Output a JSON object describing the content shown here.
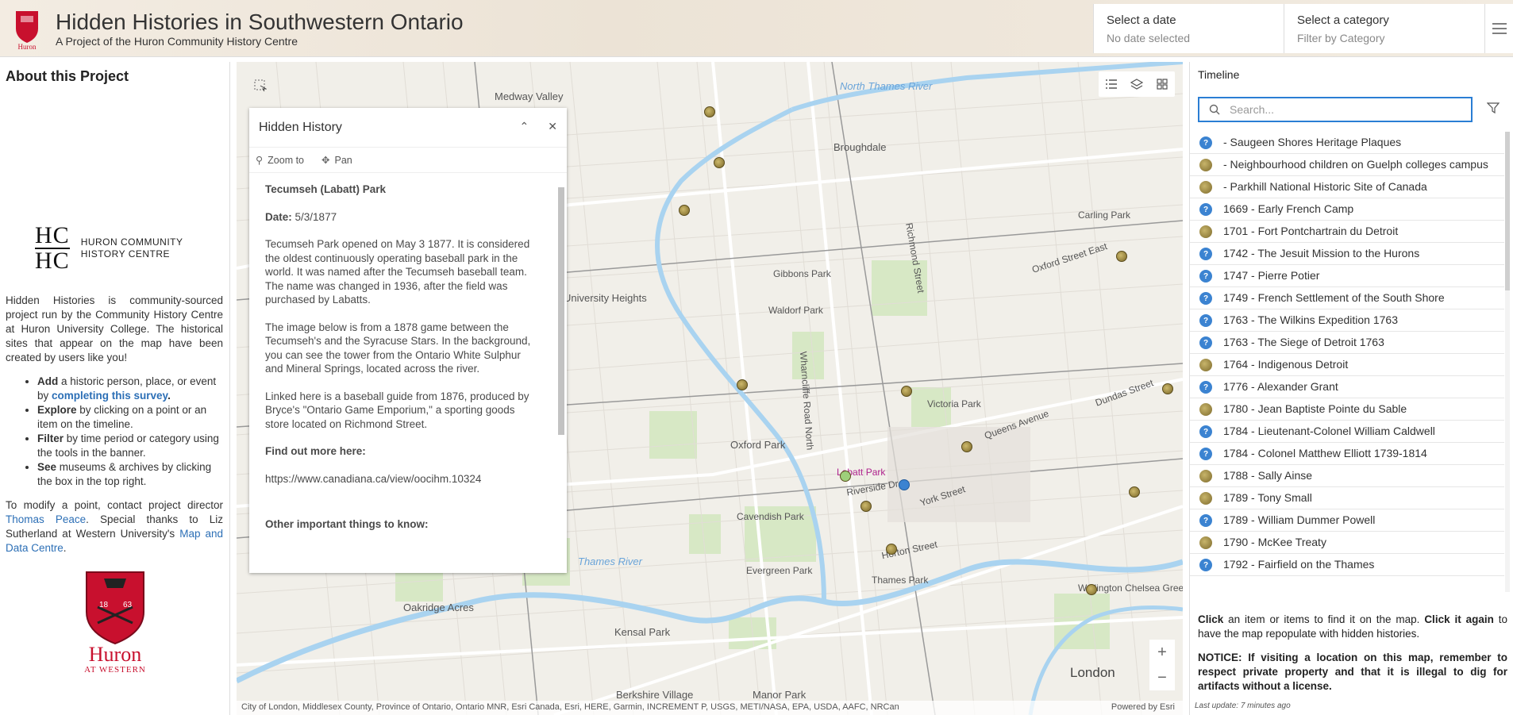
{
  "header": {
    "logo_text": "Huron",
    "title": "Hidden Histories in Southwestern Ontario",
    "subtitle": "A Project of the Huron Community History Centre",
    "date_filter": {
      "label": "Select a date",
      "value": "No date selected"
    },
    "category_filter": {
      "label": "Select a category",
      "placeholder": "Filter by Category"
    }
  },
  "about": {
    "heading": "About this Project",
    "logo_letters_top": "HC",
    "logo_letters_bottom": "HC",
    "logo_line1": "HURON COMMUNITY",
    "logo_line2": "HISTORY CENTRE",
    "intro": "Hidden Histories is community-sourced project run by the Community History Centre at Huron University College. The historical sites that appear on the map have been created by users like you!",
    "bullets": [
      {
        "bold": "Add",
        "pre": " a historic person, place, or event by ",
        "link": "completing this survey",
        "post": "."
      },
      {
        "bold": "Explore",
        "text": " by clicking on a point or an item on the timeline."
      },
      {
        "bold": "Filter",
        "text": " by time period or category using the tools in the banner."
      },
      {
        "bold": "See",
        "text": " museums & archives by clicking the box in the top right."
      }
    ],
    "contact_pre": "To modify a point, contact project director ",
    "contact_name": "Thomas Peace",
    "contact_mid": ". Special thanks to Liz Sutherland at Western University's ",
    "contact_link": "Map and Data Centre",
    "contact_post": ".",
    "shield_left": "18",
    "shield_right": "63",
    "brand": "Huron",
    "brand_sub": "AT WESTERN"
  },
  "popup": {
    "title": "Hidden History",
    "zoom_label": "Zoom to",
    "pan_label": "Pan",
    "place": "Tecumseh (Labatt) Park",
    "date_label": "Date:",
    "date_value": "5/3/1877",
    "para1": "Tecumseh Park opened on May 3 1877. It is considered the oldest continuously operating baseball park in the world. It was named after the Tecumseh baseball team. The name was changed in 1936, after the field was purchased by Labatts.",
    "para2": "The image below is from a 1878 game between the Tecumseh's and the Syracuse Stars. In the background, you can see the tower from the Ontario White Sulphur and Mineral Springs, located across the river.",
    "para3": "Linked here is a baseball guide from 1876, produced by Bryce's \"Ontario Game Emporium,\" a sporting goods store located on Richmond Street.",
    "find_more": "Find out more here:",
    "url": "https://www.canadiana.ca/view/oocihm.10324",
    "other": "Other important things to know:"
  },
  "map": {
    "labels": {
      "north_thames": "North Thames River",
      "thames": "Thames River",
      "broughdale": "Broughdale",
      "university_heights": "University Heights",
      "oxford_park": "Oxford Park",
      "london": "London",
      "kensal_park": "Kensal Park",
      "oakridge": "Oakridge Acres",
      "berkshire": "Berkshire Village",
      "manor_park": "Manor Park",
      "victoria_park": "Victoria Park",
      "labatt": "Labatt Park",
      "medway": "Medway Valley",
      "thames_park": "Thames Park",
      "wellington": "Wellington Chelsea Green Park",
      "richmond_st": "Richmond Street",
      "oxford_st": "Oxford Street East",
      "dundas": "Dundas Street",
      "queens": "Queens Avenue",
      "york": "York Street",
      "wharncliffe": "Wharncliffe Road North",
      "riverside": "Riverside Dr",
      "horton": "Horton Street",
      "carling": "Carling Park",
      "gibbons": "Gibbons Park",
      "waldorf": "Waldorf Park",
      "evergreen": "Evergreen Park",
      "cavendish": "Cavendish Park"
    },
    "attribution": "City of London, Middlesex County, Province of Ontario, Ontario MNR, Esri Canada, Esri, HERE, Garmin, INCREMENT P, USGS, METI/NASA, EPA, USDA, AAFC, NRCan",
    "powered": "Powered by Esri",
    "zoom_in": "+",
    "zoom_out": "−"
  },
  "timeline": {
    "title": "Timeline",
    "search_placeholder": "Search...",
    "items": [
      {
        "label": " - Saugeen Shores Heritage Plaques",
        "pin": "q"
      },
      {
        "label": " - Neighbourhood children on Guelph colleges campus",
        "pin": "p"
      },
      {
        "label": " - Parkhill National Historic Site of Canada",
        "pin": "p"
      },
      {
        "label": "1669 - Early French Camp",
        "pin": "q"
      },
      {
        "label": "1701 - Fort Pontchartrain du Detroit",
        "pin": "p"
      },
      {
        "label": "1742 - The Jesuit Mission to the Hurons",
        "pin": "q"
      },
      {
        "label": "1747 - Pierre Potier",
        "pin": "q"
      },
      {
        "label": "1749 - French Settlement of the South Shore",
        "pin": "q"
      },
      {
        "label": "1763 - The Wilkins Expedition 1763",
        "pin": "q"
      },
      {
        "label": "1763 - The Siege of Detroit 1763",
        "pin": "q"
      },
      {
        "label": "1764 - Indigenous Detroit",
        "pin": "p"
      },
      {
        "label": "1776 - Alexander Grant",
        "pin": "q"
      },
      {
        "label": "1780 - Jean Baptiste Pointe du Sable",
        "pin": "p"
      },
      {
        "label": "1784 - Lieutenant-Colonel William Caldwell",
        "pin": "q"
      },
      {
        "label": "1784 - Colonel Matthew Elliott 1739-1814",
        "pin": "q"
      },
      {
        "label": "1788 - Sally Ainse",
        "pin": "p"
      },
      {
        "label": "1789 - Tony Small",
        "pin": "p"
      },
      {
        "label": "1789 - William Dummer Powell",
        "pin": "q"
      },
      {
        "label": "1790 - McKee Treaty",
        "pin": "p"
      },
      {
        "label": "1792 - Fairfield on the Thames",
        "pin": "q"
      }
    ],
    "note_click": "Click",
    "note_click_text": " an item or items to find it on the map. ",
    "note_click_again": "Click it again",
    "note_click_again_text": " to have the map repopulate with hidden histories.",
    "notice": "NOTICE: If visiting a location on this map, remember to respect private property and that it is illegal to dig for artifacts without a license.",
    "last_update": "Last update: 7 minutes ago"
  },
  "colors": {
    "accent": "#2a7ed4",
    "brand_red": "#c8102e",
    "river": "#a9d3f0"
  }
}
